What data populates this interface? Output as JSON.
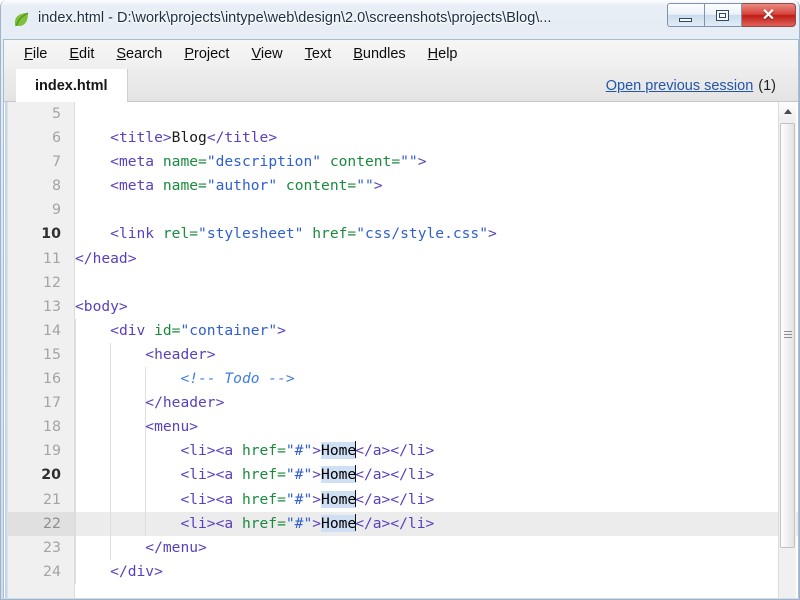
{
  "window": {
    "title": "index.html - D:\\work\\projects\\intype\\web\\design\\2.0\\screenshots\\projects\\Blog\\...",
    "app_icon": "green-leaf-icon",
    "controls": {
      "minimize": "Minimize",
      "restore": "Restore",
      "close": "✕"
    },
    "accent_close_color": "#bf1d14"
  },
  "menu": {
    "items": [
      {
        "label": "File",
        "accel": "F"
      },
      {
        "label": "Edit",
        "accel": "E"
      },
      {
        "label": "Search",
        "accel": "S"
      },
      {
        "label": "Project",
        "accel": "P"
      },
      {
        "label": "View",
        "accel": "V"
      },
      {
        "label": "Text",
        "accel": "T"
      },
      {
        "label": "Bundles",
        "accel": "B"
      },
      {
        "label": "Help",
        "accel": "H"
      }
    ]
  },
  "tabs": {
    "active": "index.html",
    "items": [
      {
        "label": "index.html",
        "active": true
      }
    ],
    "session_link": "Open previous session",
    "session_count": "(1)",
    "session_link_color": "#2356a8"
  },
  "editor": {
    "first_visible_line": 5,
    "current_line": 22,
    "selection_text": "Home",
    "selection_color": "#cfe0f5",
    "current_line_color": "#ececec",
    "syntax_colors": {
      "tag": "#5b3fbe",
      "attribute": "#1b8a3d",
      "value": "#2f5fd0",
      "text": "#1a1a1a",
      "comment": "#3f7fe0"
    },
    "lines": [
      {
        "n": 5,
        "indent": 0,
        "tokens": []
      },
      {
        "n": 6,
        "indent": 1,
        "tokens": [
          {
            "t": "tag",
            "s": "<title>"
          },
          {
            "t": "txt",
            "s": "Blog"
          },
          {
            "t": "tag",
            "s": "</title>"
          }
        ]
      },
      {
        "n": 7,
        "indent": 1,
        "tokens": [
          {
            "t": "tag",
            "s": "<meta "
          },
          {
            "t": "attr",
            "s": "name="
          },
          {
            "t": "val",
            "s": "\"description\""
          },
          {
            "t": "txt",
            "s": " "
          },
          {
            "t": "attr",
            "s": "content="
          },
          {
            "t": "val",
            "s": "\"\""
          },
          {
            "t": "tag",
            "s": ">"
          }
        ]
      },
      {
        "n": 8,
        "indent": 1,
        "tokens": [
          {
            "t": "tag",
            "s": "<meta "
          },
          {
            "t": "attr",
            "s": "name="
          },
          {
            "t": "val",
            "s": "\"author\""
          },
          {
            "t": "txt",
            "s": " "
          },
          {
            "t": "attr",
            "s": "content="
          },
          {
            "t": "val",
            "s": "\"\""
          },
          {
            "t": "tag",
            "s": ">"
          }
        ]
      },
      {
        "n": 9,
        "indent": 0,
        "tokens": []
      },
      {
        "n": 10,
        "indent": 1,
        "tokens": [
          {
            "t": "tag",
            "s": "<link "
          },
          {
            "t": "attr",
            "s": "rel="
          },
          {
            "t": "val",
            "s": "\"stylesheet\""
          },
          {
            "t": "txt",
            "s": " "
          },
          {
            "t": "attr",
            "s": "href="
          },
          {
            "t": "val",
            "s": "\"css/style.css\""
          },
          {
            "t": "tag",
            "s": ">"
          }
        ]
      },
      {
        "n": 11,
        "indent": 0,
        "tokens": [
          {
            "t": "tag",
            "s": "</head>"
          }
        ]
      },
      {
        "n": 12,
        "indent": 0,
        "tokens": []
      },
      {
        "n": 13,
        "indent": 0,
        "tokens": [
          {
            "t": "tag",
            "s": "<body>"
          }
        ]
      },
      {
        "n": 14,
        "indent": 1,
        "tokens": [
          {
            "t": "tag",
            "s": "<div "
          },
          {
            "t": "attr",
            "s": "id="
          },
          {
            "t": "val",
            "s": "\"container\""
          },
          {
            "t": "tag",
            "s": ">"
          }
        ]
      },
      {
        "n": 15,
        "indent": 2,
        "tokens": [
          {
            "t": "tag",
            "s": "<header>"
          }
        ]
      },
      {
        "n": 16,
        "indent": 3,
        "tokens": [
          {
            "t": "comment",
            "s": "<!-- Todo -->"
          }
        ]
      },
      {
        "n": 17,
        "indent": 2,
        "tokens": [
          {
            "t": "tag",
            "s": "</header>"
          }
        ]
      },
      {
        "n": 18,
        "indent": 2,
        "tokens": [
          {
            "t": "tag",
            "s": "<menu>"
          }
        ]
      },
      {
        "n": 19,
        "indent": 3,
        "tokens": [
          {
            "t": "tag",
            "s": "<li><a "
          },
          {
            "t": "attr",
            "s": "href="
          },
          {
            "t": "val",
            "s": "\"#\""
          },
          {
            "t": "tag",
            "s": ">"
          },
          {
            "t": "sel",
            "s": "Home"
          },
          {
            "t": "caret",
            "s": ""
          },
          {
            "t": "tag",
            "s": "</a></li>"
          }
        ]
      },
      {
        "n": 20,
        "indent": 3,
        "tokens": [
          {
            "t": "tag",
            "s": "<li><a "
          },
          {
            "t": "attr",
            "s": "href="
          },
          {
            "t": "val",
            "s": "\"#\""
          },
          {
            "t": "tag",
            "s": ">"
          },
          {
            "t": "sel",
            "s": "Home"
          },
          {
            "t": "caret",
            "s": ""
          },
          {
            "t": "tag",
            "s": "</a></li>"
          }
        ]
      },
      {
        "n": 21,
        "indent": 3,
        "tokens": [
          {
            "t": "tag",
            "s": "<li><a "
          },
          {
            "t": "attr",
            "s": "href="
          },
          {
            "t": "val",
            "s": "\"#\""
          },
          {
            "t": "tag",
            "s": ">"
          },
          {
            "t": "sel",
            "s": "Home"
          },
          {
            "t": "caret",
            "s": ""
          },
          {
            "t": "tag",
            "s": "</a></li>"
          }
        ]
      },
      {
        "n": 22,
        "indent": 3,
        "current": true,
        "tokens": [
          {
            "t": "tag",
            "s": "<li><a "
          },
          {
            "t": "attr",
            "s": "href="
          },
          {
            "t": "val",
            "s": "\"#\""
          },
          {
            "t": "tag",
            "s": ">"
          },
          {
            "t": "sel",
            "s": "Home"
          },
          {
            "t": "caret",
            "s": ""
          },
          {
            "t": "tag",
            "s": "</a></li>"
          }
        ]
      },
      {
        "n": 23,
        "indent": 2,
        "tokens": [
          {
            "t": "tag",
            "s": "</menu>"
          }
        ]
      },
      {
        "n": 24,
        "indent": 1,
        "tokens": [
          {
            "t": "tag",
            "s": "</div>"
          }
        ]
      }
    ]
  },
  "scrollbar": {
    "up_arrow": "scroll-up-arrow-icon",
    "thumb": "scroll-thumb"
  }
}
